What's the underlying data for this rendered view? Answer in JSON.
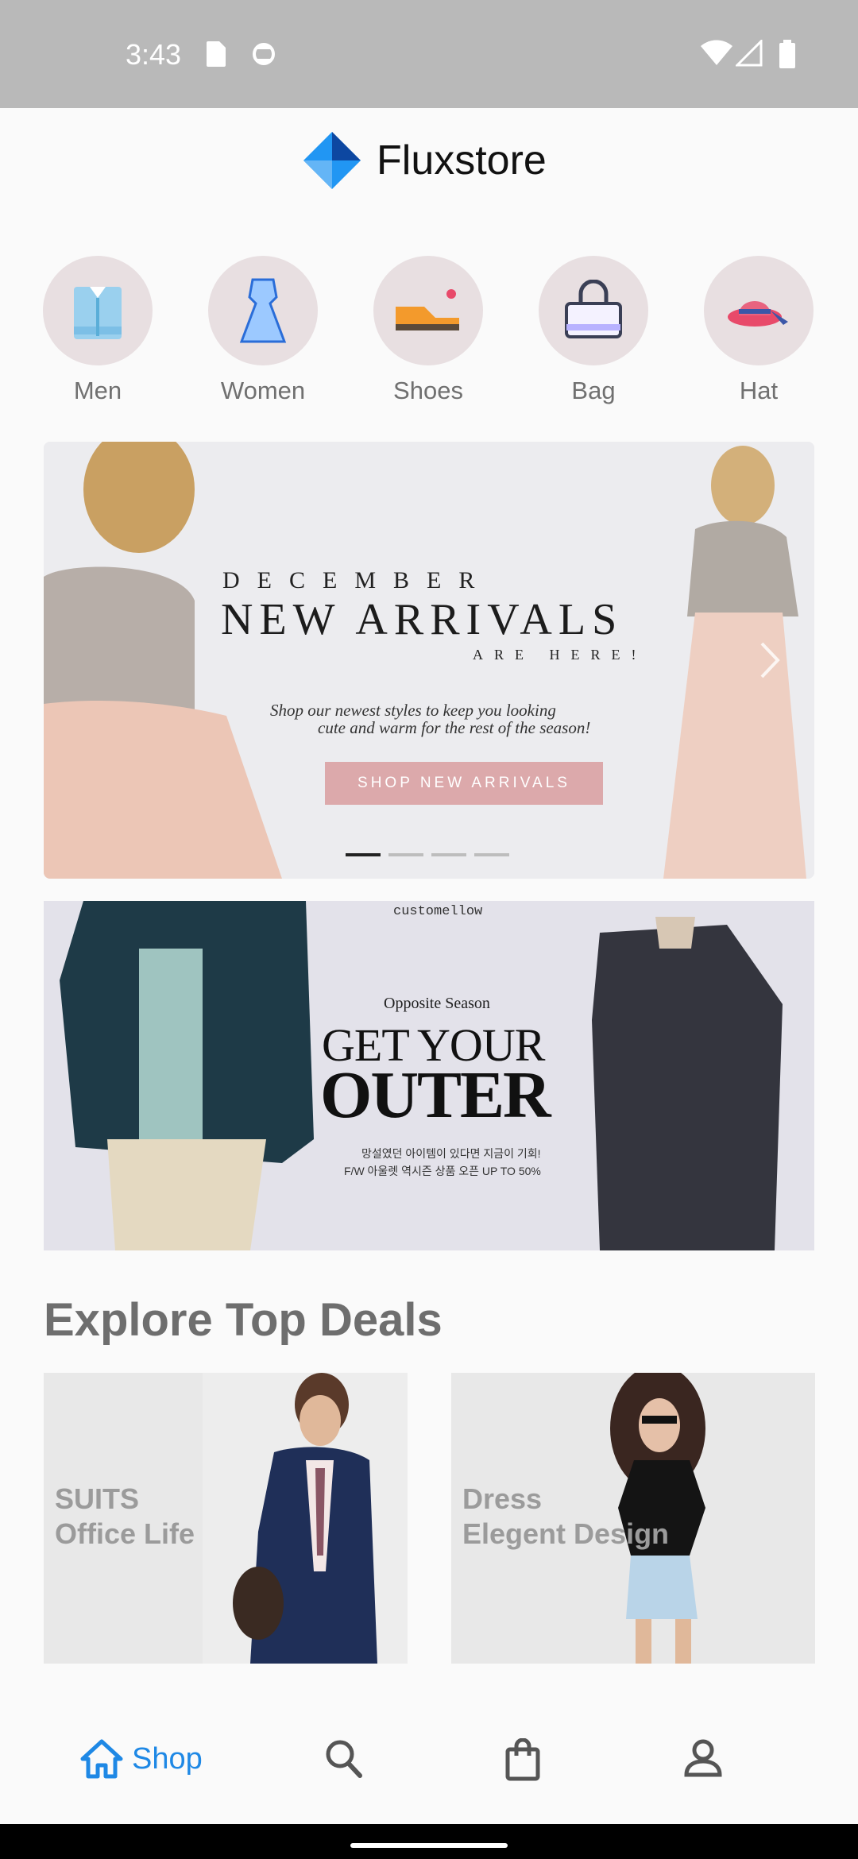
{
  "status_bar": {
    "time": "3:43"
  },
  "app": {
    "title": "Fluxstore"
  },
  "categories": [
    {
      "label": "Men",
      "icon": "shirt-icon"
    },
    {
      "label": "Women",
      "icon": "dress-icon"
    },
    {
      "label": "Shoes",
      "icon": "shoe-icon"
    },
    {
      "label": "Bag",
      "icon": "bag-icon"
    },
    {
      "label": "Hat",
      "icon": "hat-icon"
    }
  ],
  "banner1": {
    "eyebrow": "DECEMBER",
    "headline": "NEW ARRIVALS",
    "sub": "ARE HERE!",
    "copy_line1": "Shop our newest styles to keep you looking",
    "copy_line2": "cute and warm for the rest of the season!",
    "cta": "SHOP NEW ARRIVALS",
    "active_slide": 1,
    "slide_count": 4
  },
  "banner2": {
    "brand": "customellow",
    "kicker": "Opposite Season",
    "headline_top": "GET YOUR",
    "headline_bottom": "OUTER",
    "line1": "망설였던 아이템이 있다면 지금이 기회!",
    "line2": "F/W 아울렛 역시즌 상품 오픈 UP TO 50%"
  },
  "section": {
    "title": "Explore Top Deals"
  },
  "deals": [
    {
      "line1": "SUITS",
      "line2": "Office Life"
    },
    {
      "line1": "Dress",
      "line2": "Elegent Design"
    }
  ],
  "tabs": [
    {
      "label": "Shop",
      "icon": "home-icon",
      "active": true
    },
    {
      "label": "",
      "icon": "search-icon"
    },
    {
      "label": "",
      "icon": "cart-icon"
    },
    {
      "label": "",
      "icon": "profile-icon"
    }
  ],
  "colors": {
    "accent": "#1e88e5",
    "status_bar": "#b9b9b9",
    "category_bg": "#e8dfe1"
  }
}
